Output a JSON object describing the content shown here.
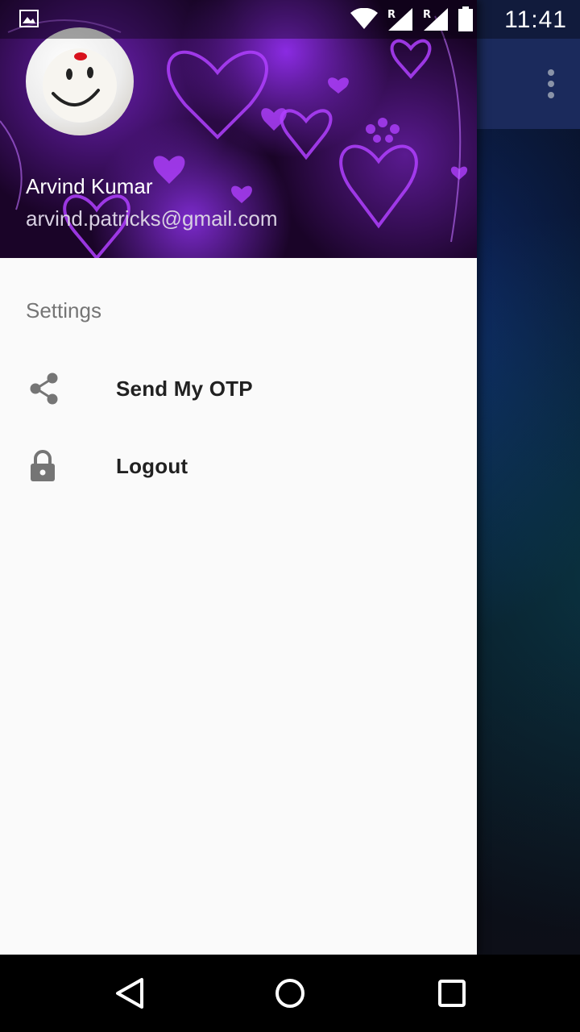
{
  "status_bar": {
    "time": "11:41",
    "network_label_1": "R",
    "network_label_2": "R"
  },
  "drawer": {
    "header": {
      "name": "Arvind Kumar",
      "email": "arvind.patricks@gmail.com"
    },
    "section_title": "Settings",
    "items": [
      {
        "label": "Send My OTP",
        "icon": "share-icon"
      },
      {
        "label": "Logout",
        "icon": "lock-icon"
      }
    ]
  },
  "colors": {
    "drawer_background": "#fafafa",
    "toolbar": "#1b2a5c",
    "header_accent": "#8a2be2"
  }
}
